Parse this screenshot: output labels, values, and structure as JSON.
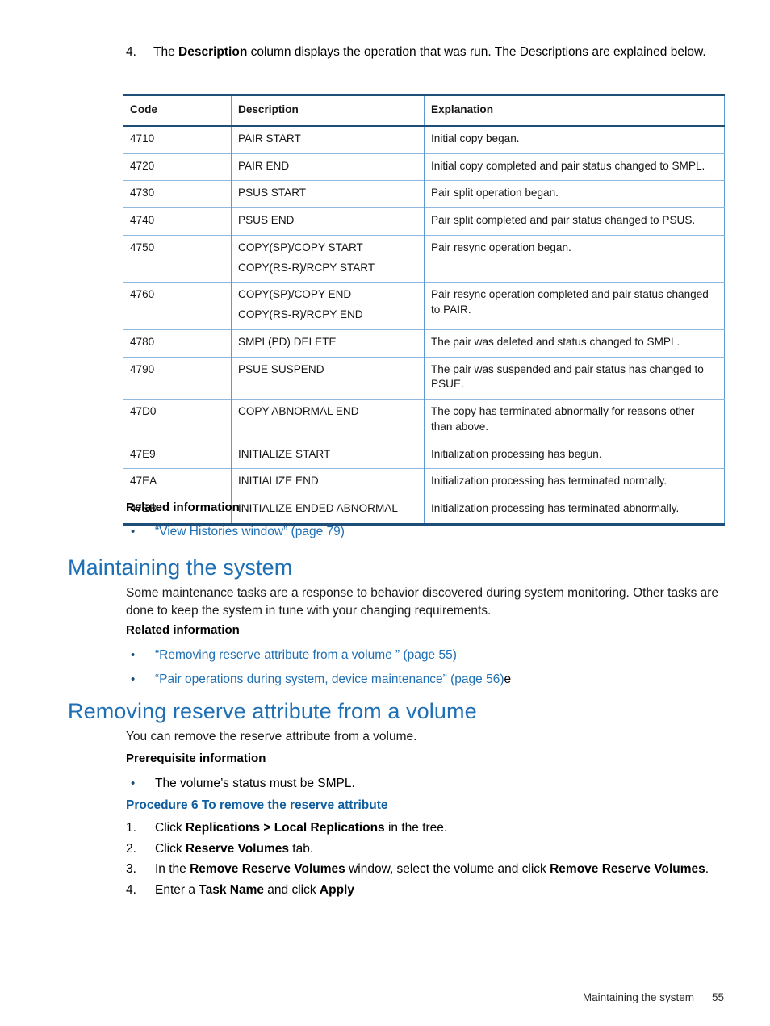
{
  "intro_step": {
    "number": "4.",
    "text_before": "The ",
    "bold1": "Description",
    "text_after": " column displays the operation that was run. The Descriptions are explained below."
  },
  "table": {
    "headers": [
      "Code",
      "Description",
      "Explanation"
    ],
    "rows": [
      {
        "code": "4710",
        "description": "PAIR START",
        "description2": "",
        "explanation": "Initial copy began."
      },
      {
        "code": "4720",
        "description": "PAIR END",
        "description2": "",
        "explanation": "Initial copy completed and pair status changed to SMPL."
      },
      {
        "code": "4730",
        "description": "PSUS START",
        "description2": "",
        "explanation": "Pair split operation began."
      },
      {
        "code": "4740",
        "description": "PSUS END",
        "description2": "",
        "explanation": "Pair split completed and pair status changed to PSUS."
      },
      {
        "code": "4750",
        "description": "COPY(SP)/COPY START",
        "description2": "COPY(RS-R)/RCPY START",
        "explanation": "Pair resync operation began."
      },
      {
        "code": "4760",
        "description": "COPY(SP)/COPY END",
        "description2": "COPY(RS-R)/RCPY END",
        "explanation": "Pair resync operation completed and pair status changed to PAIR."
      },
      {
        "code": "4780",
        "description": "SMPL(PD) DELETE",
        "description2": "",
        "explanation": "The pair was deleted and status changed to SMPL."
      },
      {
        "code": "4790",
        "description": "PSUE SUSPEND",
        "description2": "",
        "explanation": "The pair was suspended and pair status has changed to PSUE."
      },
      {
        "code": "47D0",
        "description": "COPY ABNORMAL END",
        "description2": "",
        "explanation": "The copy has terminated abnormally for reasons other than above."
      },
      {
        "code": "47E9",
        "description": "INITIALIZE START",
        "description2": "",
        "explanation": "Initialization processing has begun."
      },
      {
        "code": "47EA",
        "description": "INITIALIZE END",
        "description2": "",
        "explanation": "Initialization processing has terminated normally."
      },
      {
        "code": "47EB",
        "description": "INITIALIZE ENDED ABNORMAL",
        "description2": "",
        "explanation": "Initialization processing has terminated abnormally."
      }
    ]
  },
  "related_info_1": {
    "heading": "Related information",
    "bullet": "•",
    "link": "“View Histories window” (page 79)"
  },
  "maintaining": {
    "heading": "Maintaining the system",
    "paragraph": "Some maintenance tasks are a response to behavior discovered during system monitoring. Other tasks are done to keep the system in tune with your changing requirements.",
    "related_heading": "Related information",
    "bullet": "•",
    "link1": "“Removing reserve attribute from a volume ” (page 55)",
    "link2": "“Pair operations during system, device maintenance” (page 56)",
    "link2_suffix": "e"
  },
  "removing": {
    "heading": "Removing reserve attribute from a volume",
    "paragraph": "You can remove the reserve attribute from a volume.",
    "prereq_heading": "Prerequisite information",
    "bullet": "•",
    "prereq_item": "The volume’s status must be SMPL.",
    "procedure_heading": "Procedure 6 To remove the reserve attribute",
    "steps": [
      {
        "number": "1.",
        "pre": "Click ",
        "bold": "Replications > Local Replications",
        "post": " in the tree.",
        "bold2": "",
        "post2": ""
      },
      {
        "number": "2.",
        "pre": "Click ",
        "bold": "Reserve Volumes",
        "post": " tab.",
        "bold2": "",
        "post2": ""
      },
      {
        "number": "3.",
        "pre": "In the ",
        "bold": "Remove Reserve Volumes",
        "post": " window, select the volume and click ",
        "bold2": "Remove Reserve Volumes",
        "post2": "."
      },
      {
        "number": "4.",
        "pre": "Enter a ",
        "bold": "Task Name",
        "post": " and click ",
        "bold2": "Apply",
        "post2": ""
      }
    ]
  },
  "footer": {
    "title": "Maintaining the system",
    "page_number": "55"
  },
  "colors": {
    "heading_blue": "#1f6fb4",
    "procedure_blue": "#0f5ea0",
    "table_border_dark": "#1f4e79",
    "table_border_light": "#8fb9de"
  }
}
